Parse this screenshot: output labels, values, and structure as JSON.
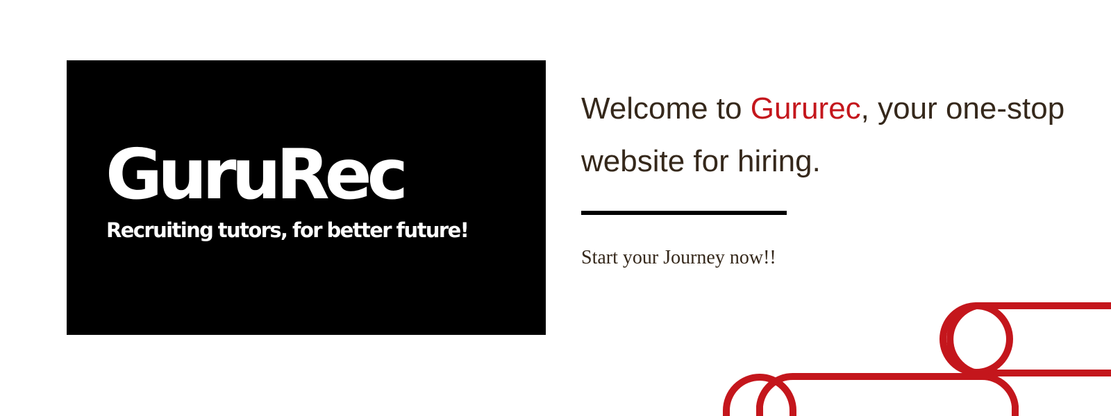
{
  "logo": {
    "title": "GuruRec",
    "tagline": "Recruiting tutors, for better future!"
  },
  "hero": {
    "headline_prefix": "Welcome to ",
    "brand": "Gururec",
    "headline_suffix": ", your one-stop website for hiring.",
    "subtext": "Start your Journey now!!"
  },
  "colors": {
    "accent": "#c4161c",
    "text": "#35281b",
    "logo_background": "#000000",
    "background": "#ffffff"
  }
}
